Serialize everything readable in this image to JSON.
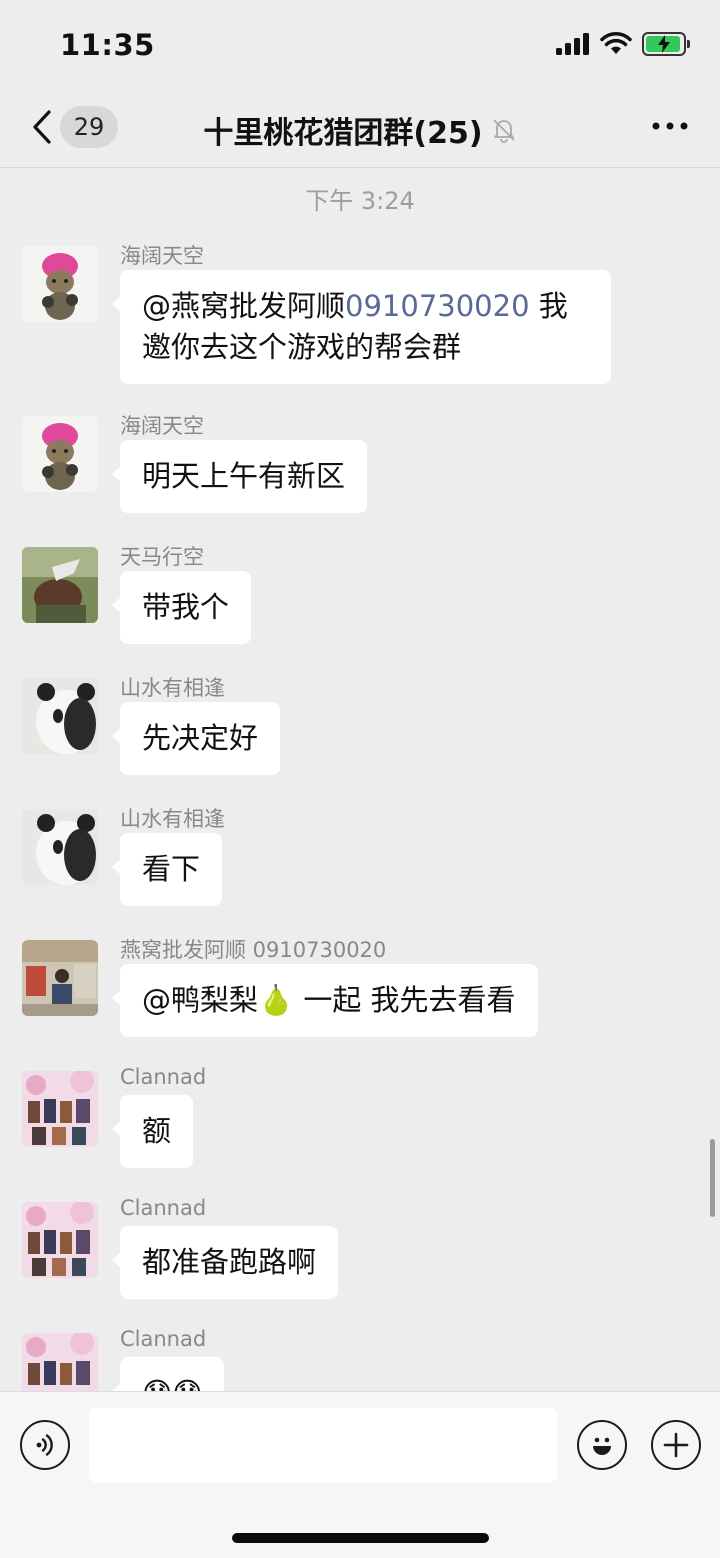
{
  "status": {
    "time": "11:35"
  },
  "nav": {
    "unread_count": "29",
    "title": "十里桃花猎团群(25)"
  },
  "chat": {
    "timestamp": "下午 3:24",
    "messages": [
      {
        "sender": "海阔天空",
        "text_pre": "@燕窝批发阿顺",
        "text_link": "0910730020",
        "text_post": " 我邀你去这个游戏的帮会群",
        "avatar": "cat-pink-hat-avatar"
      },
      {
        "sender": "海阔天空",
        "text": "明天上午有新区",
        "avatar": "cat-pink-hat-avatar"
      },
      {
        "sender": "天马行空",
        "text": "带我个",
        "avatar": "horse-photo-avatar"
      },
      {
        "sender": "山水有相逢",
        "text": "先决定好",
        "avatar": "panda-avatar"
      },
      {
        "sender": "山水有相逢",
        "text": "看下",
        "avatar": "panda-avatar"
      },
      {
        "sender": "燕窝批发阿顺 0910730020",
        "text": "@鸭梨梨🍐 一起 我先去看看",
        "avatar": "shop-photo-avatar"
      },
      {
        "sender": "Clannad",
        "text": "额",
        "avatar": "anime-collage-avatar"
      },
      {
        "sender": "Clannad",
        "text": "都准备跑路啊",
        "avatar": "anime-collage-avatar"
      },
      {
        "sender": "Clannad",
        "text": "😓😓",
        "avatar": "anime-collage-avatar"
      }
    ]
  },
  "input": {
    "value": "",
    "placeholder": ""
  },
  "colors": {
    "background": "#ededed",
    "bubble": "#ffffff",
    "link": "#576b95",
    "battery": "#34c759"
  }
}
